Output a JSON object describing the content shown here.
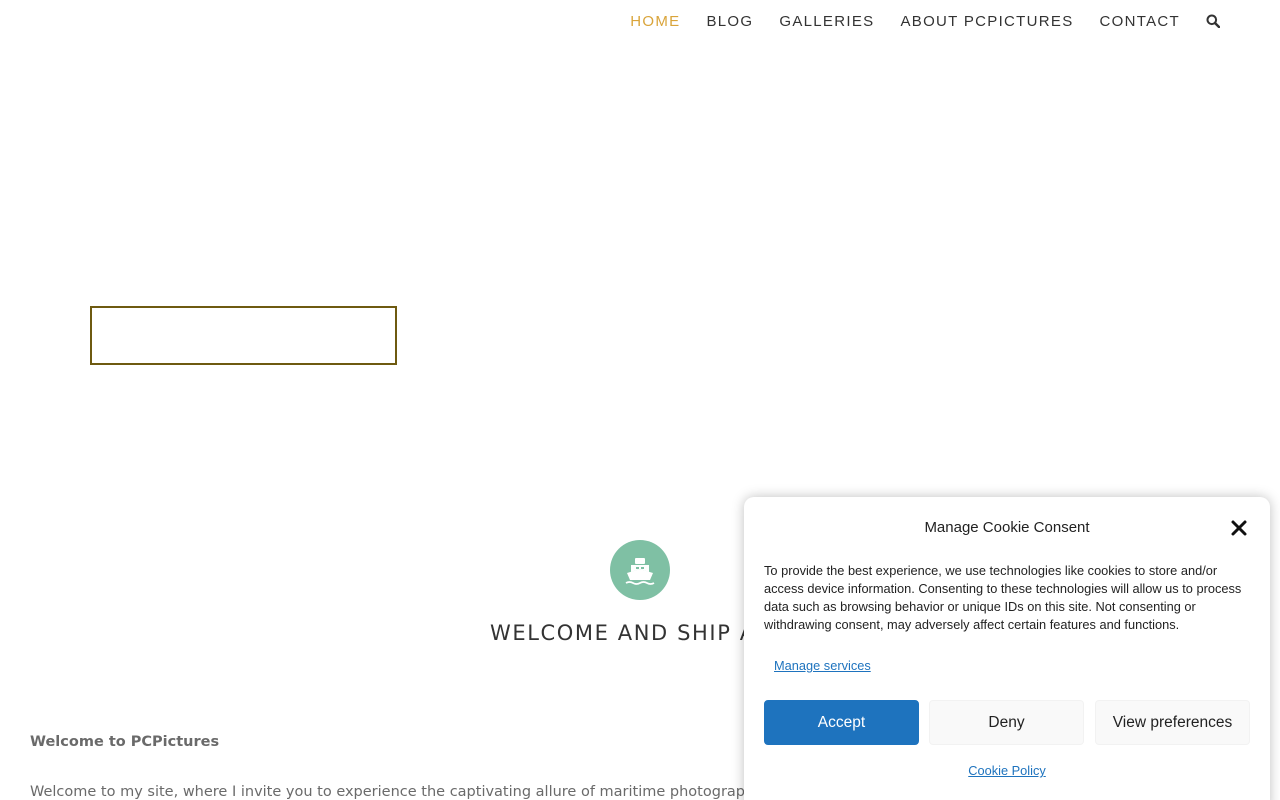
{
  "nav": {
    "items": [
      {
        "label": "HOME",
        "active": true
      },
      {
        "label": "BLOG",
        "active": false
      },
      {
        "label": "GALLERIES",
        "active": false
      },
      {
        "label": "ABOUT PCPICTURES",
        "active": false
      },
      {
        "label": "CONTACT",
        "active": false
      }
    ],
    "search_icon": "search-icon",
    "active_color": "#d9a43a"
  },
  "welcome": {
    "icon": "ship-icon",
    "icon_bg": "#7fc0a4",
    "heading": "WELCOME AND SHIP AI",
    "intro_title": "Welcome to PCPictures",
    "intro_text": "Welcome to my site, where I invite you to experience the captivating allure of maritime photography. In"
  },
  "cookie": {
    "title": "Manage Cookie Consent",
    "text": "To provide the best experience, we use technologies like cookies to store and/or access device information. Consenting to these technologies will allow us to process data such as browsing behavior or unique IDs on this site. Not consenting or withdrawing consent, may adversely affect certain features and functions.",
    "manage_services": "Manage services",
    "accept_label": "Accept",
    "deny_label": "Deny",
    "preferences_label": "View preferences",
    "policy_label": "Cookie Policy",
    "accent_color": "#1e73be"
  }
}
